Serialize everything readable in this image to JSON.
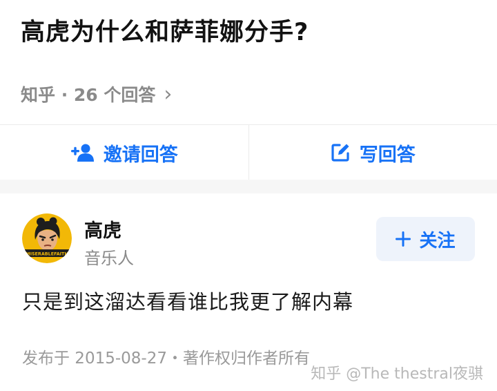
{
  "question": {
    "title": "高虎为什么和萨菲娜分手?",
    "source": "知乎 · 26 个回答",
    "chevron": "›"
  },
  "actions": {
    "invite_label": "邀请回答",
    "write_label": "写回答",
    "invite_icon": "add-user-icon",
    "write_icon": "edit-icon"
  },
  "author": {
    "name": "高虎",
    "tagline": "音乐人",
    "avatar_text": "MISERABLEFAITH",
    "follow_label": "关注"
  },
  "answer": {
    "text": "只是到这溜达看看谁比我更了解内幕",
    "footer": "发布于 2015-08-27・著作权归作者所有"
  },
  "watermark": "知乎 @The thestral夜骐",
  "colors": {
    "accent": "#1772f6",
    "avatar_bg": "#f2b807",
    "follow_bg": "#eef3fb"
  }
}
